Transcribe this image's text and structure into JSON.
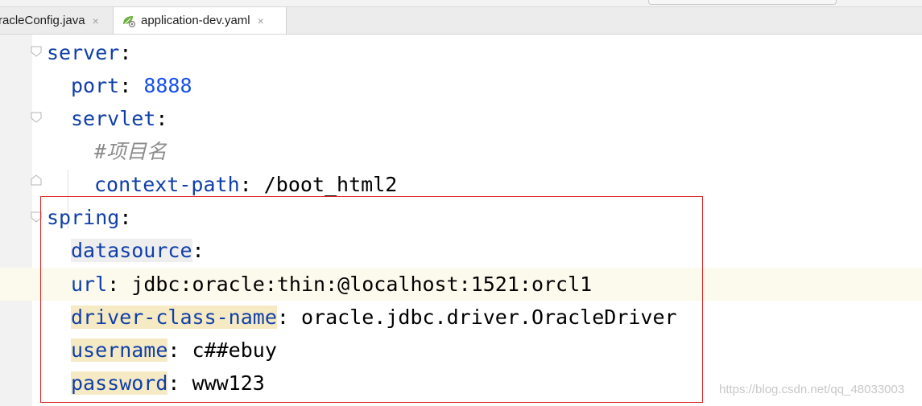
{
  "tabs": [
    {
      "label": "racleConfig.java",
      "close": "×",
      "active": false
    },
    {
      "label": "application-dev.yaml",
      "close": "×",
      "active": true,
      "icon": "spring-yaml-icon"
    }
  ],
  "code": {
    "l1": {
      "key": "server",
      "sep": ":"
    },
    "l2": {
      "key": "port",
      "sep": ": ",
      "value": "8888"
    },
    "l3": {
      "key": "servlet",
      "sep": ":"
    },
    "l4": {
      "comment": "#项目名"
    },
    "l5": {
      "key": "context-path",
      "sep": ": ",
      "value": "/boot_html2"
    },
    "l6": {
      "key": "spring",
      "sep": ":"
    },
    "l7": {
      "key": "datasource",
      "sep": ":"
    },
    "l8": {
      "key": "url",
      "sep": ": ",
      "value": "jdbc:oracle:thin:@localhost:1521:orcl1"
    },
    "l9": {
      "key": "driver-class-name",
      "sep": ": ",
      "value": "oracle.jdbc.driver.OracleDriver"
    },
    "l10": {
      "key": "username",
      "sep": ": ",
      "value": "c##ebuy"
    },
    "l11": {
      "key": "password",
      "sep": ": ",
      "value": "www123"
    }
  },
  "watermark": "https://blog.csdn.net/qq_48033003",
  "colors": {
    "key": "#0f3fa8",
    "number": "#1750eb",
    "comment": "#8c8c8c",
    "highlight": "#f5eac4",
    "annotation_box": "#e02020"
  }
}
